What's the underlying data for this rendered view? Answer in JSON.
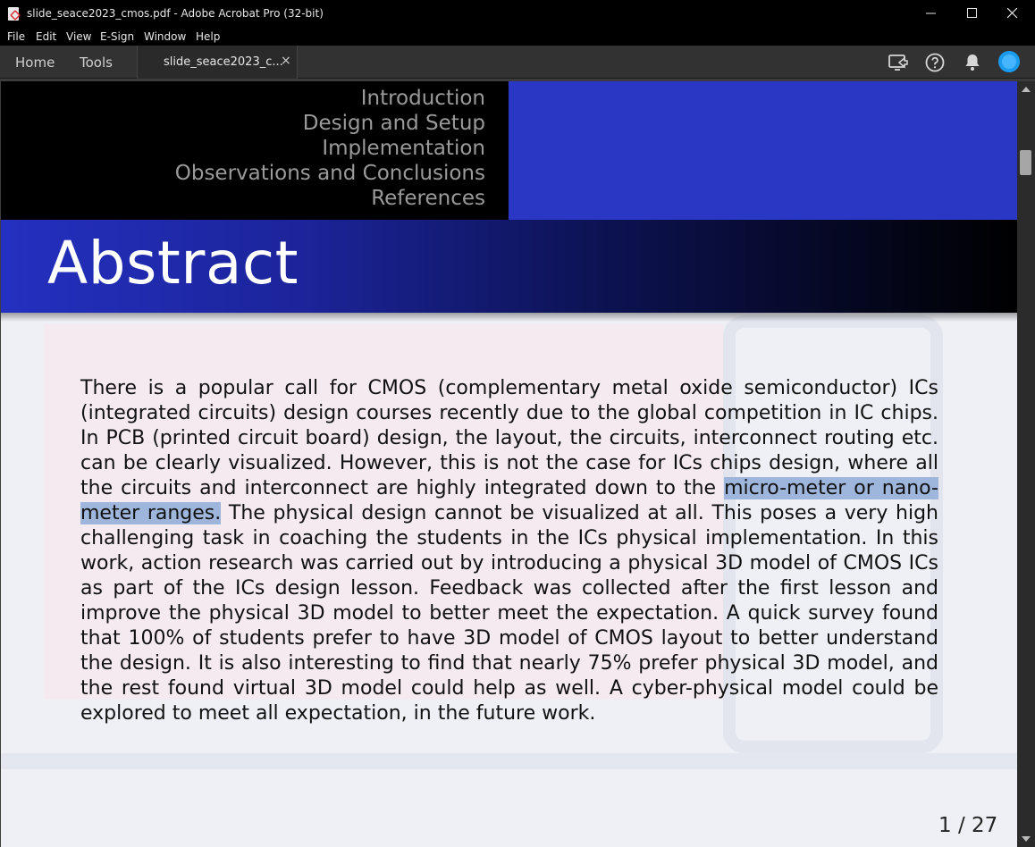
{
  "window": {
    "title": "slide_seace2023_cmos.pdf - Adobe Acrobat Pro (32-bit)"
  },
  "menu": [
    "File",
    "Edit",
    "View",
    "E-Sign",
    "Window",
    "Help"
  ],
  "tabs": {
    "home": "Home",
    "tools": "Tools",
    "document": "slide_seace2023_c...",
    "close": "×"
  },
  "toolbar_icons": [
    "share-screen-icon",
    "help-icon",
    "bell-icon",
    "avatar"
  ],
  "slide": {
    "nav": [
      "Introduction",
      "Design and Setup",
      "Implementation",
      "Observations and Conclusions",
      "References"
    ],
    "frame_title": "Abstract",
    "abstract": {
      "before_highlight": "There is a popular call for CMOS (complementary metal oxide semiconductor) ICs (integrated circuits) design courses recently due to the global competition in IC chips. In PCB (printed circuit board) design, the layout, the circuits, interconnect routing etc. can be clearly visualized. However, this is not the case for ICs chips design, where all the circuits and interconnect are highly integrated down to the ",
      "highlight": "micro-meter or nano-meter ranges.",
      "after_highlight": " The physical design cannot be visualized at all. This poses a very high challenging task in coaching the students in the ICs physical implementation. In this work, action research was carried out by introducing a physical 3D model of CMOS ICs as part of the ICs design lesson. Feedback was collected after the first lesson and improve the physical 3D model to better meet the expectation. A quick survey found that 100% of students prefer to have 3D model of CMOS layout to better understand the design. It is also interesting to find that nearly 75% prefer physical 3D model, and the rest found virtual 3D model could help as well. A cyber-physical model could be explored to meet all expectation, in the future work."
    },
    "page_number": "1 / 27"
  },
  "colors": {
    "nav_background": "#000000",
    "nav_blue": "#2a37c4",
    "highlight": "#9fb6dc"
  }
}
